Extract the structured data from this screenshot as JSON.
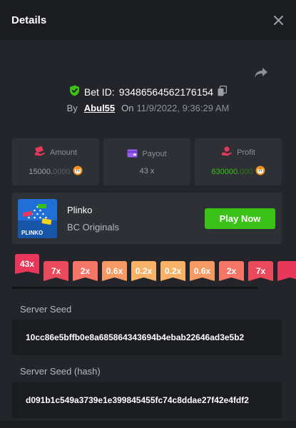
{
  "header": {
    "title": "Details"
  },
  "bet": {
    "id_label": "Bet ID:",
    "id_value": "93486564562176154",
    "by_label": "By",
    "username": "Abul55",
    "on_label": "On",
    "datetime": "11/9/2022, 9:36:29 AM"
  },
  "stats": {
    "amount": {
      "label": "Amount",
      "value_main": "15000.",
      "value_dim": "0000",
      "coin_icon": "shib-coin-icon"
    },
    "payout": {
      "label": "Payout",
      "value": "43 x"
    },
    "profit": {
      "label": "Profit",
      "value_main": "630000.",
      "value_dim": "000",
      "coin_icon": "shib-coin-icon"
    }
  },
  "game": {
    "thumb_label": "PLINKO",
    "name": "Plinko",
    "provider": "BC Originals",
    "play_label": "Play Now"
  },
  "multipliers": [
    {
      "label": "43x",
      "color": "#e8375b",
      "active": true
    },
    {
      "label": "7x",
      "color": "#ea4a5b",
      "active": false
    },
    {
      "label": "2x",
      "color": "#f57567",
      "active": false
    },
    {
      "label": "0.6x",
      "color": "#f59a63",
      "active": false
    },
    {
      "label": "0.2x",
      "color": "#f7b267",
      "active": false
    },
    {
      "label": "0.2x",
      "color": "#f7b267",
      "active": false
    },
    {
      "label": "0.6x",
      "color": "#f59a63",
      "active": false
    },
    {
      "label": "2x",
      "color": "#f57567",
      "active": false
    },
    {
      "label": "7x",
      "color": "#ea4a5b",
      "active": false
    },
    {
      "label": "",
      "color": "#e8375b",
      "active": false
    }
  ],
  "seeds": {
    "server_seed_label": "Server Seed",
    "server_seed_value": "10cc86e5bffb0e8a685864343694b4ebab22646ad3e5b2",
    "server_seed_hash_label": "Server Seed (hash)",
    "server_seed_hash_value": "d091b1c549a3739e1e399845455fc74c8ddae27f42e4fdf2"
  },
  "colors": {
    "accent_green": "#3bc117",
    "panel": "#2d3035",
    "background": "#23252a"
  }
}
